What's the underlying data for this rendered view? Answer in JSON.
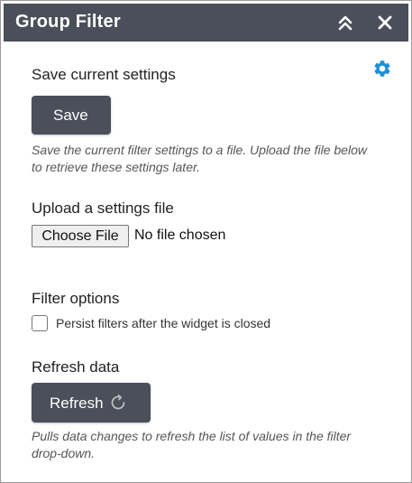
{
  "header": {
    "title": "Group Filter",
    "collapse_icon": "double-chevron-up-icon",
    "close_icon": "close-icon"
  },
  "settings_icon": "gear-icon",
  "save_section": {
    "title": "Save current settings",
    "button_label": "Save",
    "hint": "Save the current filter settings to a file. Upload the file below to retrieve these settings later."
  },
  "upload_section": {
    "title": "Upload a settings file",
    "choose_label": "Choose File",
    "file_status": "No file chosen"
  },
  "filter_options": {
    "title": "Filter options",
    "persist_label": "Persist filters after the widget is closed",
    "persist_checked": false
  },
  "refresh_section": {
    "title": "Refresh data",
    "button_label": "Refresh",
    "button_icon": "refresh-icon",
    "hint": "Pulls data changes to refresh the list of values in the filter drop-down."
  },
  "colors": {
    "header_bg": "#4a4f5a",
    "button_bg": "#4a4f5a",
    "accent": "#1e90d6"
  }
}
